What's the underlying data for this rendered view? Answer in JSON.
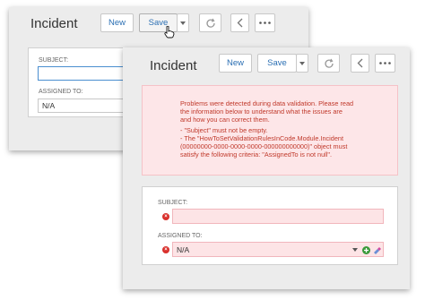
{
  "back_window": {
    "title": "Incident",
    "toolbar": {
      "new_label": "New",
      "save_label": "Save"
    },
    "subject_label": "SUBJECT:",
    "subject_value": "",
    "assigned_label": "ASSIGNED TO:",
    "assigned_value": "N/A"
  },
  "front_window": {
    "title": "Incident",
    "toolbar": {
      "new_label": "New",
      "save_label": "Save"
    },
    "validation": {
      "intro_1": "Problems were detected during data validation. Please read",
      "intro_2": "the information below to understand what the issues are",
      "intro_3": "and how you can correct them.",
      "item_1": "- \"Subject\" must not be empty.",
      "item_2a": "- The \"HowToSetValidationRulesInCode.Module.Incident",
      "item_2b": "(00000000-0000-0000-0000-000000000000)\" object must",
      "item_2c": "satisfy the following criteria: \"AssignedTo is not null\"."
    },
    "subject_label": "SUBJECT:",
    "subject_value": "",
    "assigned_label": "ASSIGNED TO:",
    "assigned_value": "N/A"
  },
  "colors": {
    "accent": "#2b6fb3",
    "error": "#c0392b",
    "error_bg": "#fde6e8"
  }
}
